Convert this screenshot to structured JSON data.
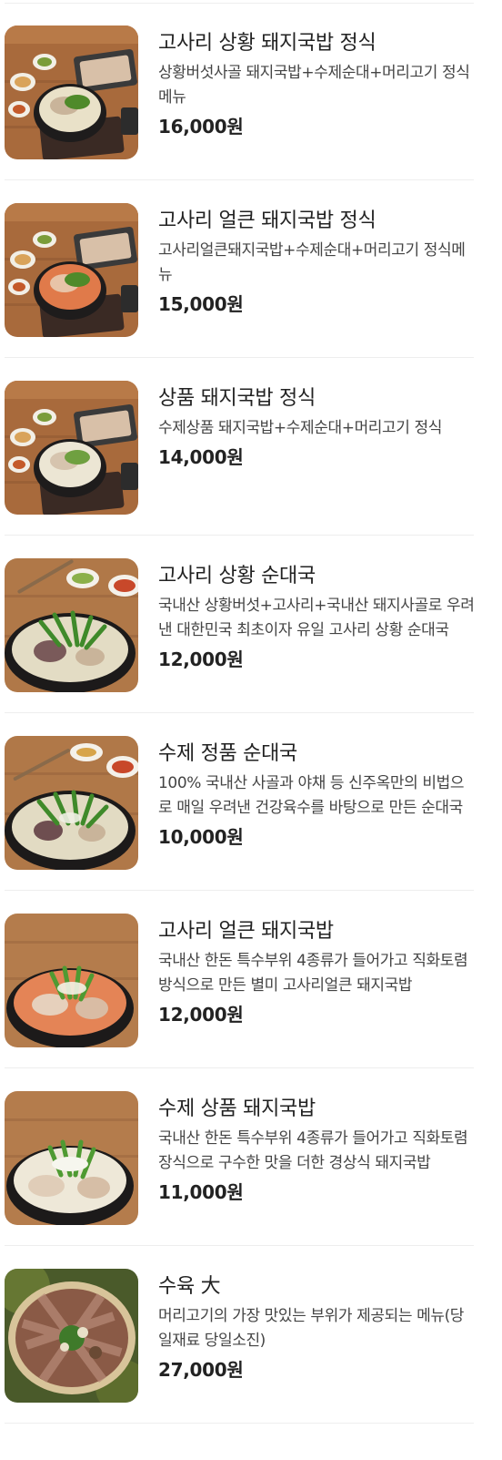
{
  "menu": {
    "items": [
      {
        "name": "고사리 상황 돼지국밥 정식",
        "description": "상황버섯사골 돼지국밥+수제순대+머리고기 정식메뉴",
        "price": "16,000원",
        "photo": "set-meal-pork-soup-photo",
        "broth_color": "#e9e1c8"
      },
      {
        "name": "고사리 얼큰 돼지국밥 정식",
        "description": "고사리얼큰돼지국밥+수제순대+머리고기 정식메뉴",
        "price": "15,000원",
        "photo": "set-meal-spicy-pork-soup-photo",
        "broth_color": "#e07a4a"
      },
      {
        "name": "상품 돼지국밥 정식",
        "description": "수제상품 돼지국밥+수제순대+머리고기 정식",
        "price": "14,000원",
        "photo": "set-meal-pork-soup-photo",
        "broth_color": "#ece6d4"
      },
      {
        "name": "고사리 상황 순대국",
        "description": "국내산 상황버섯+고사리+국내산 돼지사골로 우려낸 대한민국 최초이자 유일 고사리 상황 순대국",
        "price": "12,000원",
        "photo": "sundae-soup-photo",
        "broth_color": "#e3dcc4"
      },
      {
        "name": "수제 정품 순대국",
        "description": "100% 국내산 사골과 야채 등 신주옥만의 비법으로 매일 우려낸 건강육수를 바탕으로 만든 순대국",
        "price": "10,000원",
        "photo": "sundae-soup-photo",
        "broth_color": "#e2dbc3"
      },
      {
        "name": "고사리 얼큰 돼지국밥",
        "description": "국내산 한돈 특수부위 4종류가 들어가고 직화토렴 방식으로 만든 별미 고사리얼큰 돼지국밥",
        "price": "12,000원",
        "photo": "spicy-pork-soup-photo",
        "broth_color": "#e48456"
      },
      {
        "name": "수제 상품 돼지국밥",
        "description": "국내산 한돈 특수부위 4종류가 들어가고 직화토렴 장식으로 구수한 맛을 더한 경상식 돼지국밥",
        "price": "11,000원",
        "photo": "pork-soup-photo",
        "broth_color": "#eee8d8"
      },
      {
        "name": "수육 大",
        "description": "머리고기의 가장 맛있는 부위가 제공되는 메뉴(당일재료 당일소진)",
        "price": "27,000원",
        "photo": "boiled-pork-platter-photo",
        "broth_color": "#8a5a46"
      }
    ]
  }
}
